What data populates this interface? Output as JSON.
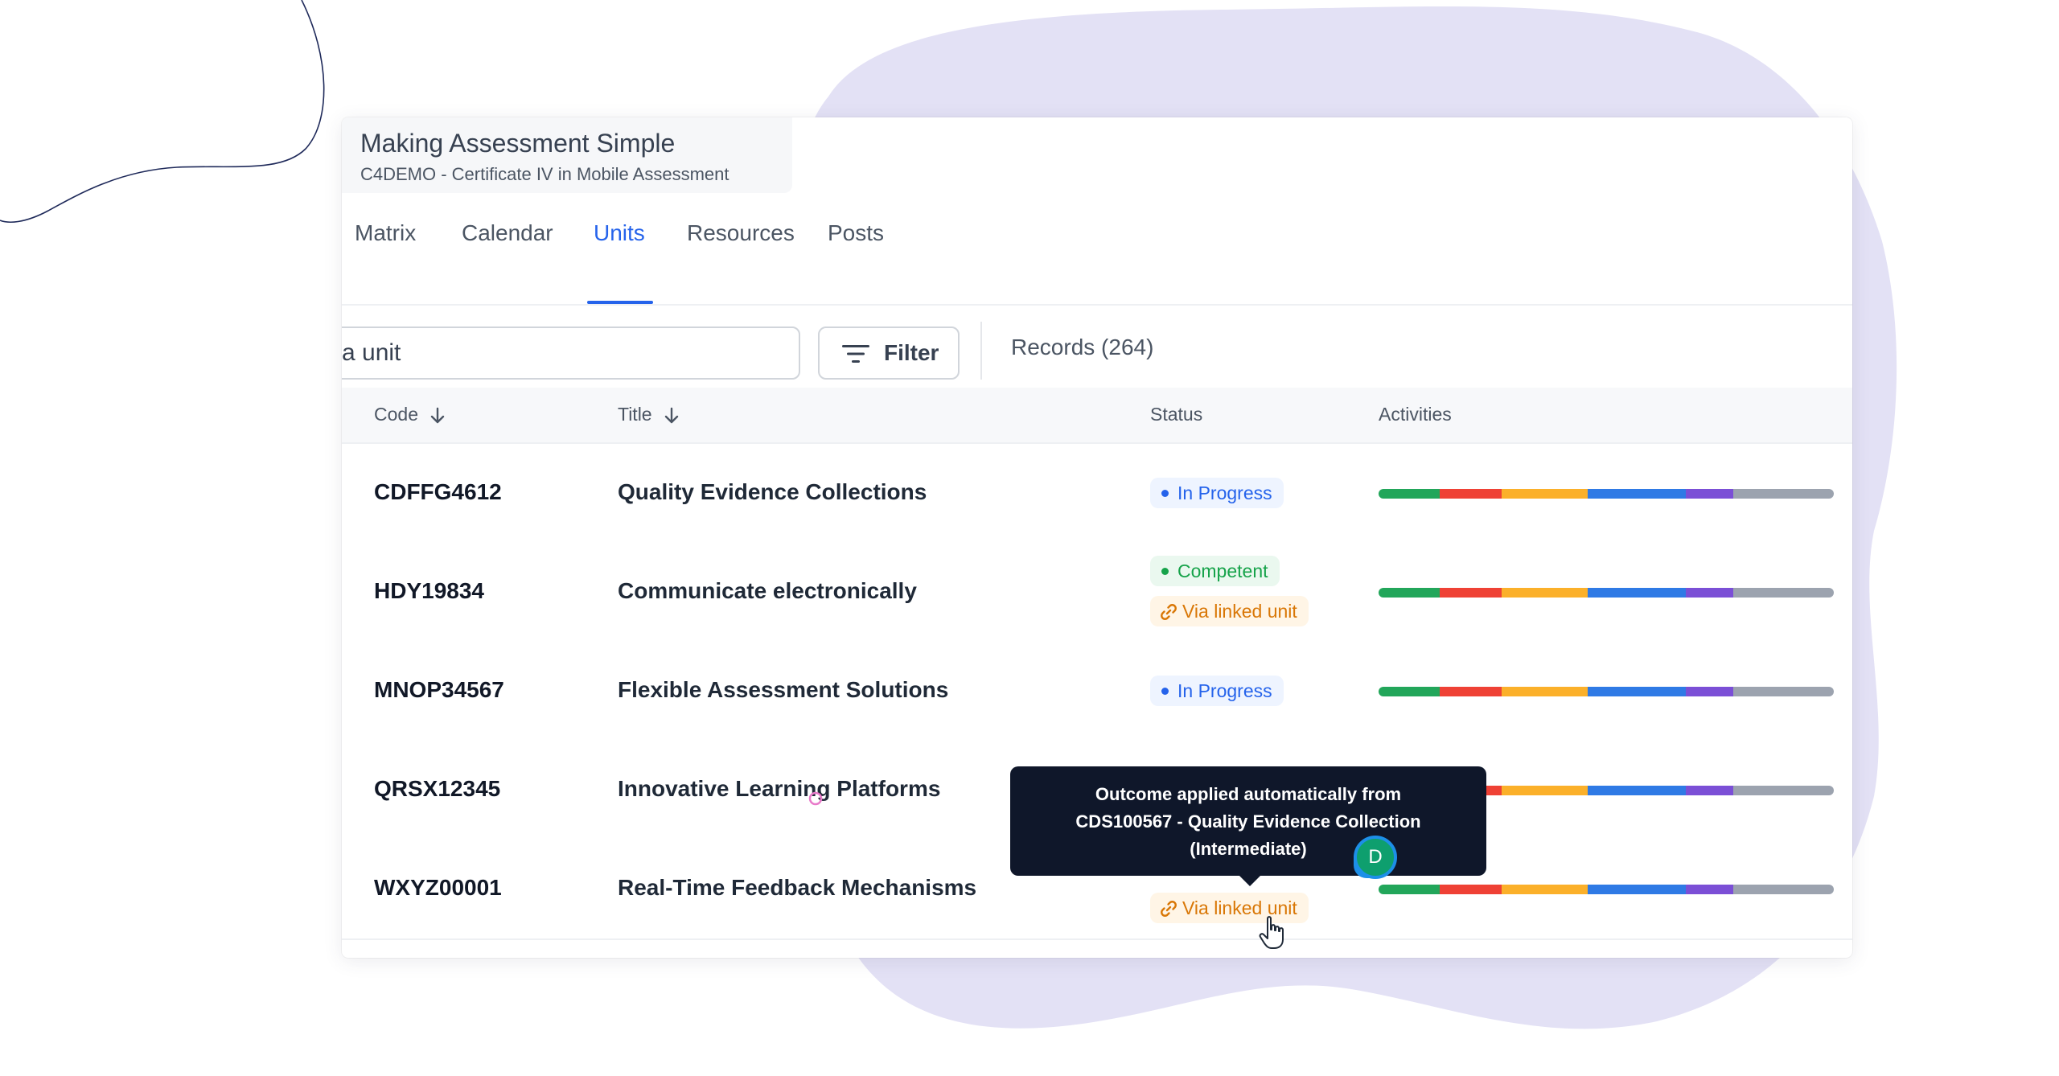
{
  "app": {
    "title": "Making Assessment Simple",
    "subtitle": "C4DEMO - Certificate IV in Mobile Assessment"
  },
  "tabs": [
    {
      "label": "Matrix",
      "active": false
    },
    {
      "label": "Calendar",
      "active": false
    },
    {
      "label": "Units",
      "active": true
    },
    {
      "label": "Resources",
      "active": false
    },
    {
      "label": "Posts",
      "active": false
    }
  ],
  "toolbar": {
    "search_value": "a unit",
    "filter_label": "Filter",
    "records_label": "Records (264)"
  },
  "table": {
    "headers": {
      "code": "Code",
      "title": "Title",
      "status": "Status",
      "activities": "Activities"
    },
    "rows": [
      {
        "code": "CDFFG4612",
        "title": "Quality Evidence Collections",
        "status": "In Progress"
      },
      {
        "code": "HDY19834",
        "title": "Communicate electronically",
        "status": "Competent",
        "linked": "Via linked unit"
      },
      {
        "code": "MNOP34567",
        "title": "Flexible Assessment Solutions",
        "status": "In Progress"
      },
      {
        "code": "QRSX12345",
        "title": "Innovative Learning Platforms"
      },
      {
        "code": "WXYZ00001",
        "title": "Real-Time Feedback Mechanisms",
        "linked": "Via linked unit"
      }
    ]
  },
  "activity_colors": [
    "#22a65a",
    "#ef4135",
    "#fbb02a",
    "#2f7ae5",
    "#7b4fd6",
    "#9ca3af"
  ],
  "activity_shares": [
    0.135,
    0.135,
    0.19,
    0.215,
    0.105,
    0.22
  ],
  "tooltip": {
    "line1": "Outcome applied automatically from",
    "line2": "CDS100567 - Quality Evidence Collection",
    "line3": "(Intermediate)"
  },
  "avatar": {
    "initial": "D"
  },
  "colors": {
    "accent": "#2563eb",
    "blob": "#e3e1f5",
    "competent": "#16a34a",
    "linked": "#d97706"
  }
}
